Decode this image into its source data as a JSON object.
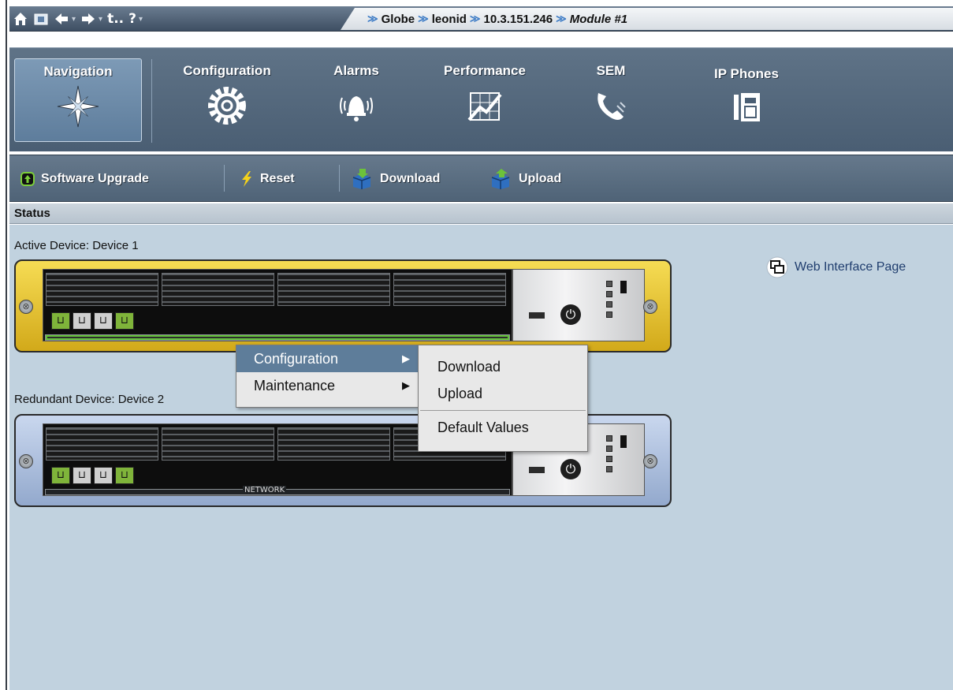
{
  "breadcrumb": {
    "items": [
      "Globe",
      "leonid",
      "10.3.151.246"
    ],
    "current": "Module #1"
  },
  "topbar": {
    "icons": [
      "home-icon",
      "folder-icon",
      "back-icon",
      "forward-icon",
      "up-icon",
      "help-icon"
    ],
    "up_label": "t..",
    "help_label": "?"
  },
  "tabs": [
    {
      "label": "Navigation",
      "icon": "compass-star-icon",
      "active": true
    },
    {
      "label": "Configuration",
      "icon": "gear-icon"
    },
    {
      "label": "Alarms",
      "icon": "bell-icon"
    },
    {
      "label": "Performance",
      "icon": "chart-icon"
    },
    {
      "label": "SEM",
      "icon": "phone-handset-icon"
    },
    {
      "label": "IP Phones",
      "icon": "desk-phone-icon"
    }
  ],
  "actions": [
    {
      "label": "Software Upgrade",
      "icon": "upgrade-icon"
    },
    {
      "label": "Reset",
      "icon": "lightning-icon"
    },
    {
      "label": "Download",
      "icon": "download-box-icon"
    },
    {
      "label": "Upload",
      "icon": "upload-box-icon"
    }
  ],
  "status": {
    "header": "Status",
    "active_device": "Active Device: Device 1",
    "redundant_device": "Redundant Device: Device 2",
    "web_link": "Web Interface Page",
    "network_label": "NETWORK"
  },
  "context_menu": {
    "items": [
      {
        "label": "Configuration",
        "highlighted": true
      },
      {
        "label": "Maintenance"
      }
    ],
    "submenu": {
      "items": [
        "Download",
        "Upload"
      ],
      "after_separator": "Default Values"
    }
  },
  "colors": {
    "active_chassis": "#e8c53a",
    "redundant_chassis": "#b4c6e4",
    "content_bg": "#c1d2df",
    "highlight": "#5e7d9a"
  }
}
